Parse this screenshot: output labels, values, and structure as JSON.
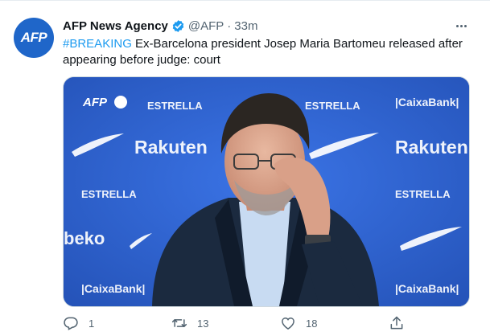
{
  "tweet": {
    "avatar_text": "AFP",
    "author_name": "AFP News Agency",
    "handle": "@AFP",
    "separator": "·",
    "time": "33m",
    "hashtag": "#BREAKING",
    "text": " Ex-Barcelona president Josep Maria Bartomeu released after appearing before judge: court",
    "photo": {
      "watermark": "AFP",
      "sponsor_estrella": "ESTRELLA",
      "sponsor_rakuten": "Rakuten",
      "sponsor_beko": "beko",
      "sponsor_caixa": "|CaixaBank|"
    },
    "actions": {
      "reply_count": "1",
      "retweet_count": "13",
      "like_count": "18"
    }
  },
  "colors": {
    "link": "#1d9bf0",
    "backdrop_blue": "#2e60cf",
    "verified": "#1d9bf0"
  }
}
